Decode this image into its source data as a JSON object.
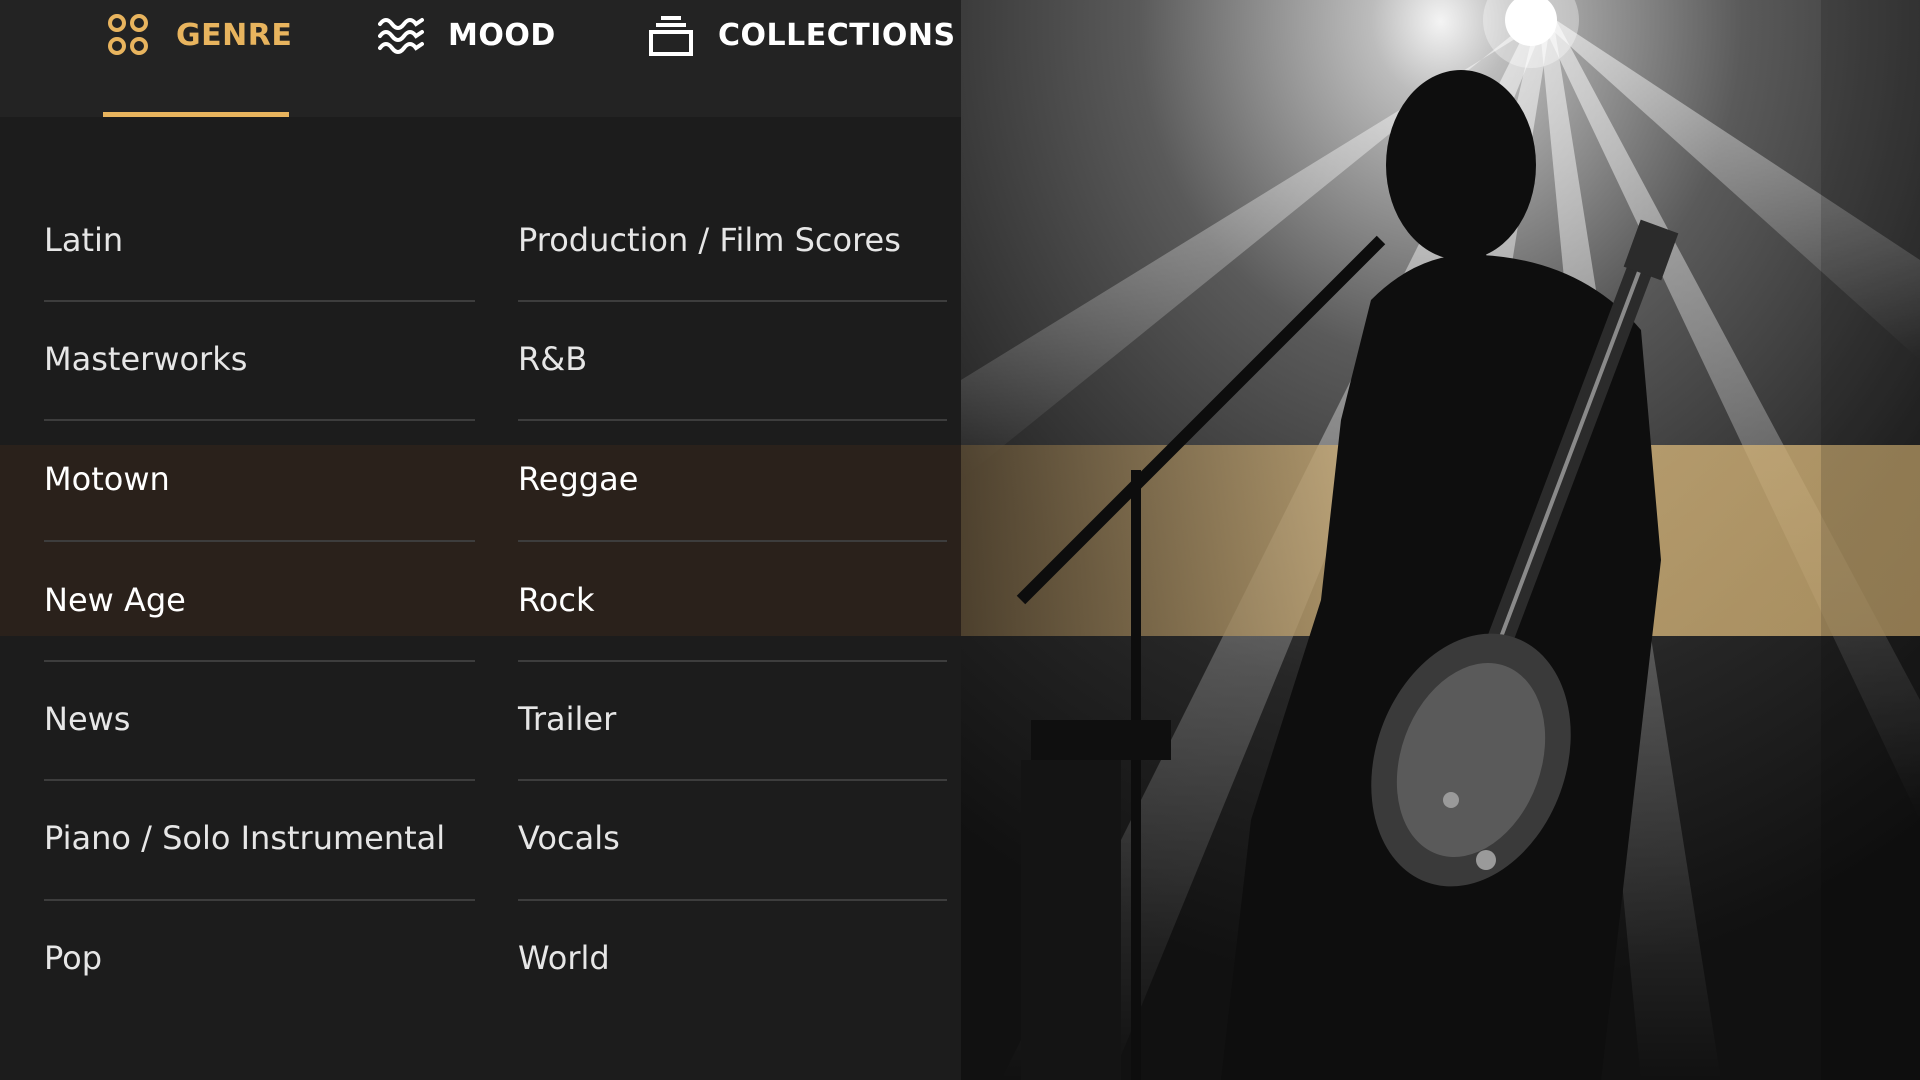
{
  "tabs": [
    {
      "id": "genre",
      "label": "GENRE",
      "icon": "genre-circles-icon",
      "active": true
    },
    {
      "id": "mood",
      "label": "MOOD",
      "icon": "waves-icon",
      "active": false
    },
    {
      "id": "collections",
      "label": "COLLECTIONS",
      "icon": "stack-icon",
      "active": false
    }
  ],
  "genres": {
    "left": [
      "Latin",
      "Masterworks",
      "Motown",
      "New Age",
      "News",
      "Piano / Solo Instrumental",
      "Pop"
    ],
    "right": [
      "Production / Film Scores",
      "R&B",
      "Reggae",
      "Rock",
      "Trailer",
      "Vocals",
      "World"
    ]
  },
  "colors": {
    "accent": "#e8b45e",
    "background": "#1c1c1c",
    "tabbar": "#232323",
    "highlight": "#2a211b",
    "divider": "#3d3d3d"
  },
  "photo": {
    "subject": "guitarist-photo"
  }
}
